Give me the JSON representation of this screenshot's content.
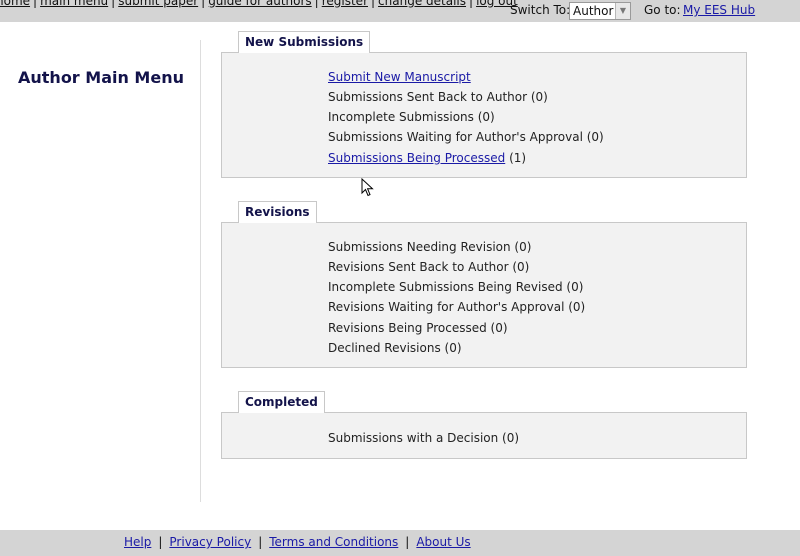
{
  "topnav": {
    "links": [
      "home",
      "main menu",
      "submit paper",
      "guide for authors",
      "register",
      "change details",
      "log out"
    ],
    "switch_label": "Switch To:",
    "role_value": "Author",
    "goto_label": "Go to:",
    "goto_link": "My EES Hub"
  },
  "page_title": "Author Main Menu",
  "sections": {
    "new_submissions": {
      "title": "New Submissions",
      "submit_link": "Submit New Manuscript",
      "sent_back": "Submissions Sent Back to Author (0)",
      "incomplete": "Incomplete Submissions (0)",
      "waiting": "Submissions Waiting for Author's Approval (0)",
      "processed_link": "Submissions Being Processed",
      "processed_count": "(1)"
    },
    "revisions": {
      "title": "Revisions",
      "items": [
        "Submissions Needing Revision (0)",
        "Revisions Sent Back to Author (0)",
        "Incomplete Submissions Being Revised (0)",
        "Revisions Waiting for Author's Approval (0)",
        "Revisions Being Processed (0)",
        "Declined Revisions (0)"
      ]
    },
    "completed": {
      "title": "Completed",
      "items": [
        "Submissions with a Decision (0)"
      ]
    }
  },
  "footer": {
    "links": [
      "Help",
      "Privacy Policy",
      "Terms and Conditions",
      "About Us"
    ]
  },
  "colors": {
    "link": "#1a1aa6",
    "title": "#13134a",
    "bar": "#d4d4d4",
    "panel": "#f2f2f2"
  },
  "icons": [
    "dropdown-arrow-icon",
    "mouse-cursor-icon"
  ]
}
